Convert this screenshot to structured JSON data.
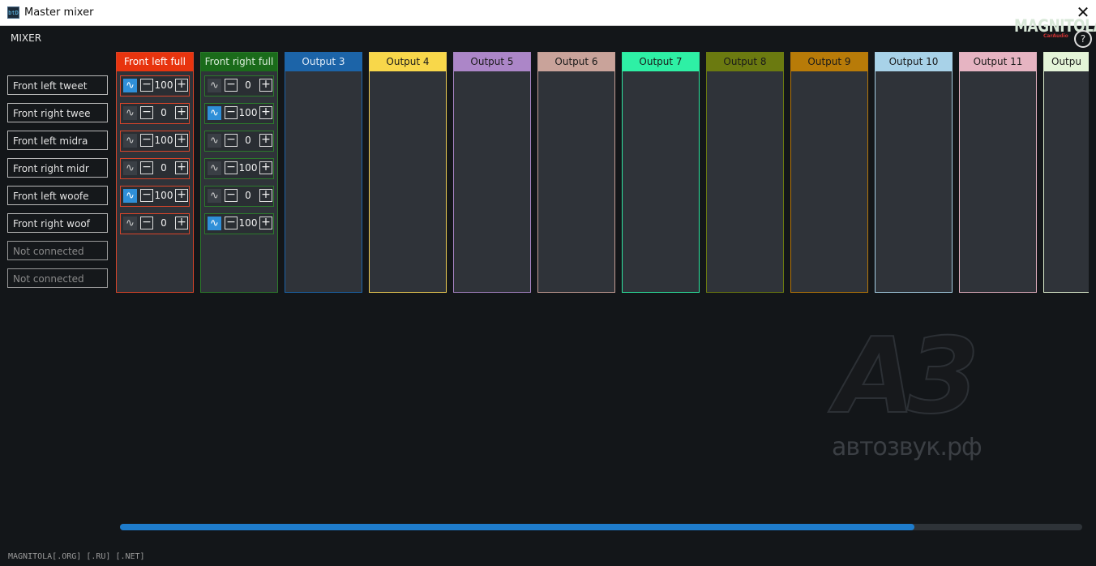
{
  "window": {
    "icon_text": "btD",
    "title": "Master mixer",
    "close_label": "✕"
  },
  "mixer_label": "MIXER",
  "logo": {
    "text": "MAGNITOLA",
    "subtext": "CarAudio"
  },
  "help_label": "?",
  "inputs": [
    {
      "label": "Front left tweet",
      "connected": true
    },
    {
      "label": "Front right twee",
      "connected": true
    },
    {
      "label": "Front left midra",
      "connected": true
    },
    {
      "label": "Front right midr",
      "connected": true
    },
    {
      "label": "Front left woofe",
      "connected": true
    },
    {
      "label": "Front right woof",
      "connected": true
    },
    {
      "label": "Not connected",
      "connected": false
    },
    {
      "label": "Not connected",
      "connected": false
    }
  ],
  "outputs": [
    {
      "label": "Front left full",
      "color": "#e8340e",
      "text_color": "#ffffff",
      "border_color": "#d9452a",
      "cells": [
        {
          "active": true,
          "value": "100"
        },
        {
          "active": false,
          "value": "0"
        },
        {
          "active": false,
          "value": "100"
        },
        {
          "active": false,
          "value": "0"
        },
        {
          "active": true,
          "value": "100"
        },
        {
          "active": false,
          "value": "0"
        }
      ]
    },
    {
      "label": "Front right full",
      "color": "#1a6b1a",
      "text_color": "#d8ecd8",
      "border_color": "#2c7a2c",
      "cells": [
        {
          "active": false,
          "value": "0"
        },
        {
          "active": true,
          "value": "100"
        },
        {
          "active": false,
          "value": "0"
        },
        {
          "active": false,
          "value": "100"
        },
        {
          "active": false,
          "value": "0"
        },
        {
          "active": true,
          "value": "100"
        }
      ]
    },
    {
      "label": "Output 3",
      "color": "#1c64a8",
      "text_color": "#e2ecf8",
      "border_color": "#1c64a8",
      "cells": []
    },
    {
      "label": "Output 4",
      "color": "#f8d74a",
      "text_color": "#1a1a1a",
      "border_color": "#f0cf55",
      "cells": []
    },
    {
      "label": "Output 5",
      "color": "#ac86c8",
      "text_color": "#1a1a1a",
      "border_color": "#a683c2",
      "cells": []
    },
    {
      "label": "Output 6",
      "color": "#c9a39a",
      "text_color": "#1a1a1a",
      "border_color": "#c29c93",
      "cells": []
    },
    {
      "label": "Output 7",
      "color": "#2ef0a5",
      "text_color": "#1a1a1a",
      "border_color": "#2ee6a0",
      "cells": []
    },
    {
      "label": "Output 8",
      "color": "#6b7a10",
      "text_color": "#1a1a1a",
      "border_color": "#6b7a10",
      "cells": []
    },
    {
      "label": "Output 9",
      "color": "#b87b08",
      "text_color": "#1a1a1a",
      "border_color": "#b5770a",
      "cells": []
    },
    {
      "label": "Output 10",
      "color": "#a8d2e8",
      "text_color": "#1a1a1a",
      "border_color": "#a5cde3",
      "cells": []
    },
    {
      "label": "Output 11",
      "color": "#e6b4c2",
      "text_color": "#1a1a1a",
      "border_color": "#dfaebd",
      "cells": []
    },
    {
      "label": "Outpu",
      "color": "#e4f4d8",
      "text_color": "#1a1a1a",
      "border_color": "#e0f0d0",
      "cells": []
    }
  ],
  "watermark": {
    "big": "A3",
    "small": "автозвук.рф"
  },
  "scroll": {
    "position_fraction": 0.826
  },
  "footer": "MAGNITOLA[.ORG] [.RU] [.NET]"
}
